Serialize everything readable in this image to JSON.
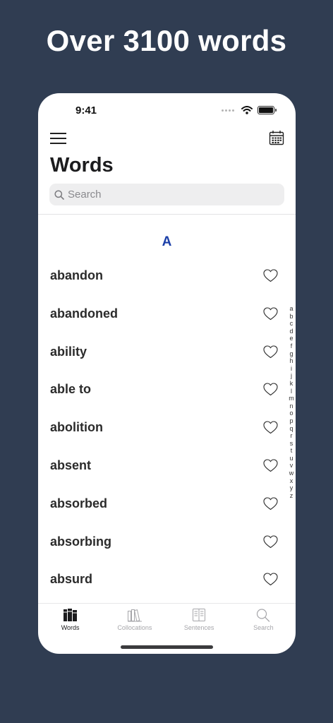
{
  "headline": "Over 3100 words",
  "status_bar": {
    "time": "9:41"
  },
  "nav": {
    "title": "Words"
  },
  "search": {
    "placeholder": "Search"
  },
  "section": {
    "letter": "A"
  },
  "words": [
    "abandon",
    "abandoned",
    "ability",
    "able to",
    "abolition",
    "absent",
    "absorbed",
    "absorbing",
    "absurd"
  ],
  "index_letters": [
    "a",
    "b",
    "c",
    "d",
    "e",
    "f",
    "g",
    "h",
    "i",
    "j",
    "k",
    "l",
    "m",
    "n",
    "o",
    "p",
    "q",
    "r",
    "s",
    "t",
    "u",
    "v",
    "w",
    "x",
    "y",
    "z"
  ],
  "tabs": [
    {
      "label": "Words",
      "icon": "books-icon",
      "active": true
    },
    {
      "label": "Collocations",
      "icon": "library-icon",
      "active": false
    },
    {
      "label": "Sentences",
      "icon": "book-open-icon",
      "active": false
    },
    {
      "label": "Search",
      "icon": "search-icon",
      "active": false
    }
  ],
  "colors": {
    "background": "#303d52",
    "accent": "#1b3fa8"
  }
}
